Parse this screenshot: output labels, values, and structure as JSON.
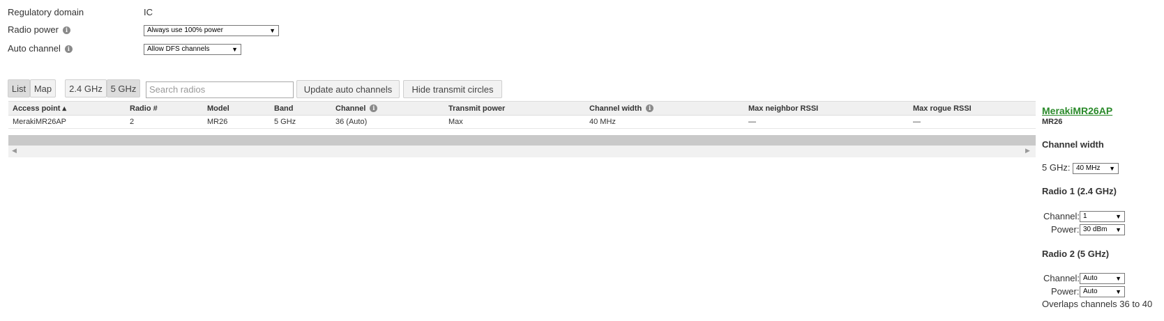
{
  "settings": {
    "regulatory_domain_label": "Regulatory domain",
    "regulatory_domain_value": "IC",
    "radio_power_label": "Radio power",
    "radio_power_value": "Always use 100% power",
    "auto_channel_label": "Auto channel",
    "auto_channel_value": "Allow DFS channels"
  },
  "toolbar": {
    "view_list": "List",
    "view_map": "Map",
    "band_24": "2.4 GHz",
    "band_5": "5 GHz",
    "search_placeholder": "Search radios",
    "update_button": "Update auto channels",
    "hide_button": "Hide transmit circles"
  },
  "table": {
    "columns": [
      "Access point ▴",
      "Radio #",
      "Model",
      "Band",
      "Channel",
      "Transmit power",
      "Channel width",
      "Max neighbor RSSI",
      "Max rogue RSSI"
    ],
    "rows": [
      [
        "MerakiMR26AP",
        "2",
        "MR26",
        "5 GHz",
        "36 (Auto)",
        "Max",
        "40 MHz",
        "—",
        "—"
      ]
    ]
  },
  "sidepanel": {
    "ap_name": "MerakiMR26AP",
    "ap_model": "MR26",
    "channel_width_heading": "Channel width",
    "cw_label": "5 GHz:",
    "cw_value": "40 MHz",
    "radio1_heading": "Radio 1 (2.4 GHz)",
    "radio1_channel_label": "Channel:",
    "radio1_channel_value": "1",
    "radio1_power_label": "Power:",
    "radio1_power_value": "30 dBm",
    "radio2_heading": "Radio 2 (5 GHz)",
    "radio2_channel_label": "Channel:",
    "radio2_channel_value": "Auto",
    "radio2_power_label": "Power:",
    "radio2_power_value": "Auto",
    "overlap_note": "Overlaps channels 36 to 40"
  },
  "icons": {
    "info": "info-icon",
    "caret": "caret-down-icon",
    "sort": "sort-asc-icon"
  },
  "colors": {
    "link_green": "#2a8a2a",
    "scrollbar": "#c9c9c9",
    "header_bg": "#f0f0f0"
  }
}
